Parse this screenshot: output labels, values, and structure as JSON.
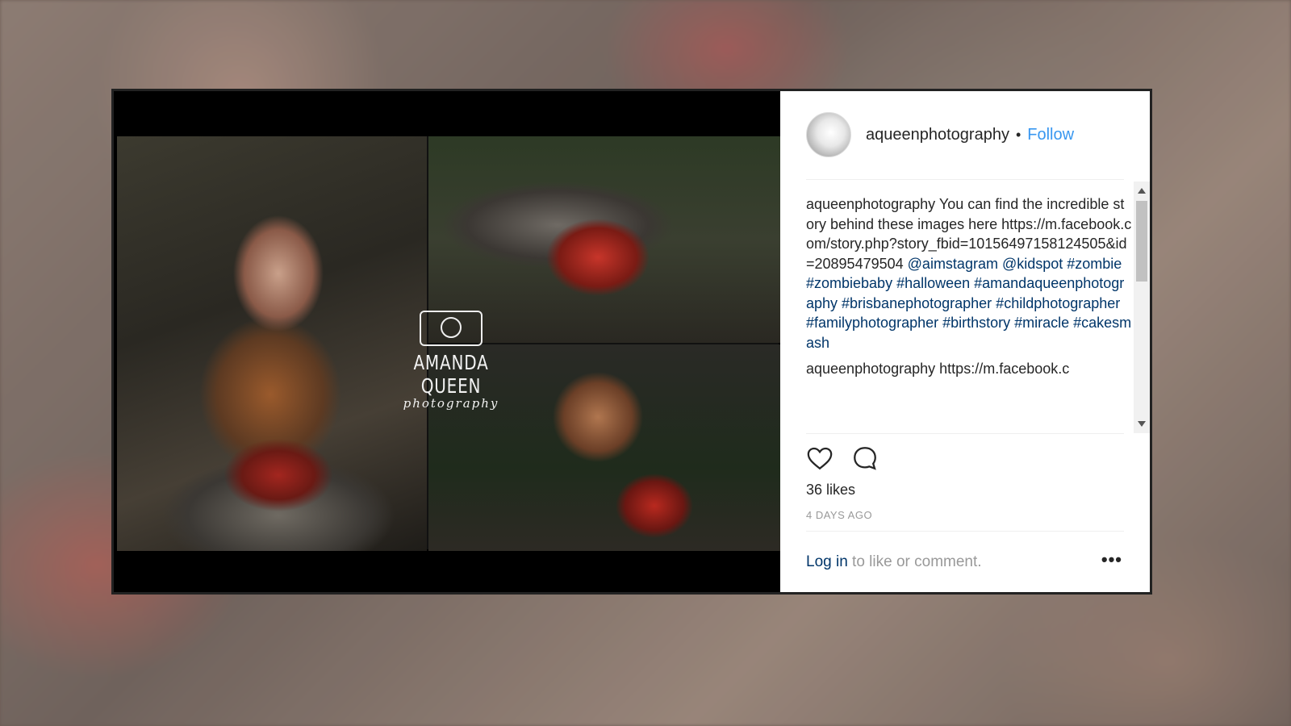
{
  "post": {
    "username": "aqueenphotography",
    "separator": "•",
    "follow_label": "Follow",
    "caption": {
      "username": "aqueenphotography",
      "text": "You can find the incredible story behind these images here https://m.facebook.com/story.php?story_fbid=10156497158124505&id=20895479504",
      "tags": "@aimstagram @kidspot #zombie #zombiebaby #halloween #amandaqueenphotography #brisbanephotographer #childphotographer #familyphotographer #birthstory #miracle #cakesmash"
    },
    "second_comment": {
      "username": "aqueenphotography",
      "text": "https://m.facebook.c"
    },
    "likes": "36 likes",
    "time": "4 DAYS AGO",
    "login_link": "Log in",
    "login_rest": " to like or comment.",
    "more": "•••"
  },
  "watermark": {
    "name": "AMANDA QUEEN",
    "sub": "photography"
  },
  "icons": {
    "like": "heart-icon",
    "comment": "comment-bubble-icon",
    "more": "more-options-icon",
    "logo": "camera-icon"
  },
  "colors": {
    "link": "#3897f0",
    "hashtag": "#003569",
    "text": "#262626",
    "muted": "#999999"
  }
}
